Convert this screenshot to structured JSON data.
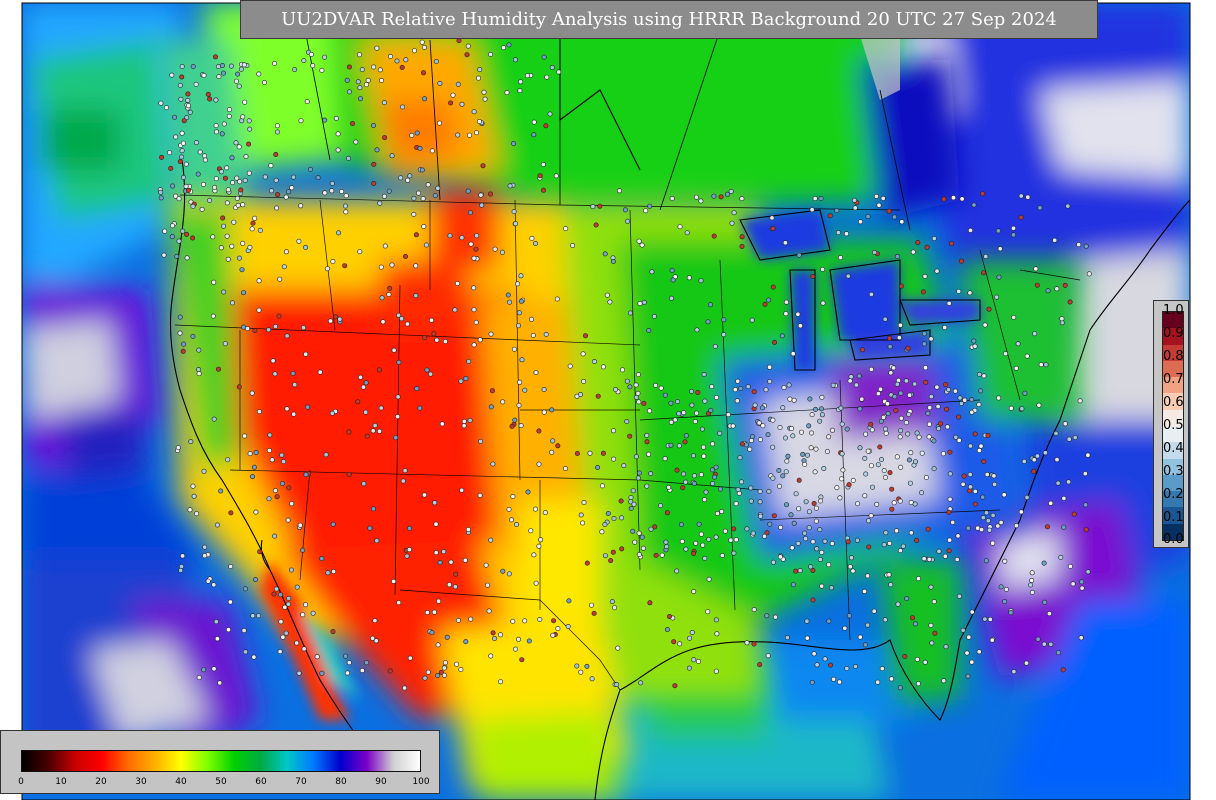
{
  "title": "UU2DVAR Relative Humidity Analysis using HRRR Background 20 UTC 27 Sep 2024",
  "obs_legend": {
    "ticks": [
      "1.0",
      "0.9",
      "0.8",
      "0.7",
      "0.6",
      "0.5",
      "0.4",
      "0.3",
      "0.2",
      "0.1",
      "0.0"
    ],
    "colors": [
      "#67001f",
      "#a5131f",
      "#c63b35",
      "#dd6d52",
      "#f0a283",
      "#f8cdb6",
      "#f6ebe4",
      "#e8eff3",
      "#c3dbea",
      "#91c2de",
      "#5b9bc9",
      "#3479b1",
      "#1a5594",
      "#053061"
    ]
  },
  "rh_legend": {
    "ticks": [
      "0",
      "10",
      "20",
      "30",
      "40",
      "50",
      "60",
      "70",
      "80",
      "90",
      "100"
    ],
    "gradient": [
      "#000000",
      "#4a0000",
      "#c80000",
      "#ff0000",
      "#ff6a00",
      "#ffb000",
      "#ffff00",
      "#7fff00",
      "#00d000",
      "#00aa44",
      "#00c8c8",
      "#0078ff",
      "#0000cd",
      "#7a00c8",
      "#d0d0d0",
      "#ffffff"
    ]
  }
}
